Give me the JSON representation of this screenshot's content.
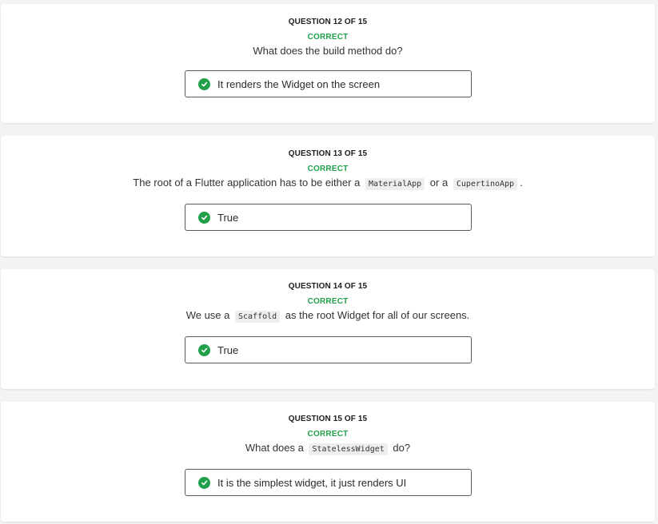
{
  "questions": [
    {
      "counter": "QUESTION 12 OF 15",
      "status": "CORRECT",
      "text_parts": [
        "What does the build method do?"
      ],
      "answer": "It renders the Widget on the screen"
    },
    {
      "counter": "QUESTION 13 OF 15",
      "status": "CORRECT",
      "text_parts": [
        "The root of a Flutter application has to be either a",
        "MaterialApp",
        "or a",
        "CupertinoApp",
        "."
      ],
      "answer": "True"
    },
    {
      "counter": "QUESTION 14 OF 15",
      "status": "CORRECT",
      "text_parts": [
        "We use a",
        "Scaffold",
        "as the root Widget for all of our screens."
      ],
      "answer": "True"
    },
    {
      "counter": "QUESTION 15 OF 15",
      "status": "CORRECT",
      "text_parts": [
        "What does a",
        "StatelessWidget",
        "do?"
      ],
      "answer": "It is the simplest widget, it just renders UI"
    }
  ],
  "colors": {
    "correct": "#21a04b",
    "page_background": "#f2f3f5",
    "card_background": "#ffffff"
  },
  "icons": {
    "answer_status": "check-circle-icon"
  }
}
